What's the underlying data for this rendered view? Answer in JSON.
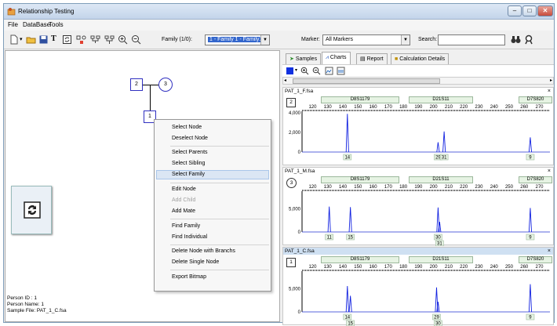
{
  "window": {
    "title": "Relationship Testing",
    "min": "–",
    "max": "□",
    "close": "✕"
  },
  "menu": [
    "File",
    "DataBase",
    "Tools"
  ],
  "toolbar": {
    "family_label": "Family (1/0):",
    "family_value": "1 - Family 1 - Family1",
    "marker_label": "Marker:",
    "marker_value": "All Markers",
    "search_label": "Search:",
    "search_value": ""
  },
  "pedigree": {
    "nodes": [
      {
        "id": "2",
        "shape": "square"
      },
      {
        "id": "3",
        "shape": "circle"
      },
      {
        "id": "1",
        "shape": "square"
      }
    ]
  },
  "context_menu": [
    {
      "label": "Select Node",
      "enabled": true
    },
    {
      "label": "Deselect Node",
      "enabled": true
    },
    {
      "label": "Select Parents",
      "enabled": true
    },
    {
      "label": "Select Sibling",
      "enabled": true
    },
    {
      "label": "Select Family",
      "enabled": true,
      "highlight": true
    },
    {
      "label": "Edit Node",
      "enabled": true
    },
    {
      "label": "Add Child",
      "enabled": false
    },
    {
      "label": "Add Mate",
      "enabled": true
    },
    {
      "label": "Find Family",
      "enabled": true
    },
    {
      "label": "Find Individual",
      "enabled": true
    },
    {
      "label": "Delete Node with Branchs",
      "enabled": true
    },
    {
      "label": "Delete Single Node",
      "enabled": true
    },
    {
      "label": "Export Bitmap",
      "enabled": true
    }
  ],
  "status": {
    "person_id": "Person ID : 1",
    "person_name": "Person Name: 1",
    "sample_file": "Sample File: PAT_1_C.fsa"
  },
  "tabs": [
    "Samples",
    "Charts",
    "Report",
    "Calculation Details"
  ],
  "active_tab": "Charts",
  "chart_data": [
    {
      "type": "line",
      "title": "PAT_1_F.fsa",
      "node": "2",
      "node_shape": "square",
      "markers": [
        "D8S1179",
        "D21S11",
        "D7S820"
      ],
      "x_ticks": [
        "120",
        "130",
        "140",
        "150",
        "160",
        "170",
        "180",
        "190",
        "200",
        "210",
        "220",
        "230",
        "240",
        "250",
        "260",
        "270"
      ],
      "xlim": [
        113,
        277
      ],
      "y_ticks": [
        "0",
        "2,000",
        "4,000"
      ],
      "ylim": [
        0,
        4000
      ],
      "peaks": [
        {
          "x": 143,
          "y": 3900
        },
        {
          "x": 203,
          "y": 1000
        },
        {
          "x": 207,
          "y": 2100
        },
        {
          "x": 264,
          "y": 1500
        }
      ],
      "allele_labels": [
        {
          "x": 143,
          "text": "14",
          "row": 1
        },
        {
          "x": 203,
          "text": "29",
          "row": 1
        },
        {
          "x": 207,
          "text": "31",
          "row": 1
        },
        {
          "x": 264,
          "text": "9",
          "row": 1
        }
      ]
    },
    {
      "type": "line",
      "title": "PAT_1_M.fsa",
      "node": "3",
      "node_shape": "circle",
      "markers": [
        "D8S1179",
        "D21S11",
        "D7S820"
      ],
      "x_ticks": [
        "120",
        "130",
        "140",
        "150",
        "160",
        "170",
        "180",
        "190",
        "200",
        "210",
        "220",
        "230",
        "240",
        "250",
        "260",
        "270"
      ],
      "xlim": [
        113,
        277
      ],
      "y_ticks": [
        "0",
        "5,000"
      ],
      "ylim": [
        0,
        8500
      ],
      "peaks": [
        {
          "x": 131,
          "y": 5500
        },
        {
          "x": 145,
          "y": 5400
        },
        {
          "x": 203,
          "y": 5300
        },
        {
          "x": 204,
          "y": 2200
        },
        {
          "x": 264,
          "y": 5200
        }
      ],
      "allele_labels": [
        {
          "x": 131,
          "text": "11",
          "row": 1
        },
        {
          "x": 145,
          "text": "15",
          "row": 1
        },
        {
          "x": 203,
          "text": "30",
          "row": 1
        },
        {
          "x": 204,
          "text": "31",
          "row": 2
        },
        {
          "x": 264,
          "text": "9",
          "row": 1
        }
      ]
    },
    {
      "type": "line",
      "title": "PAT_1_C.fsa",
      "node": "1",
      "node_shape": "square",
      "selected": true,
      "markers": [
        "D8S1179",
        "D21S11",
        "D7S820"
      ],
      "x_ticks": [
        "120",
        "130",
        "140",
        "150",
        "160",
        "170",
        "180",
        "190",
        "200",
        "210",
        "220",
        "230",
        "240",
        "250",
        "260",
        "270"
      ],
      "xlim": [
        113,
        277
      ],
      "y_ticks": [
        "0",
        "5,000"
      ],
      "ylim": [
        0,
        8500
      ],
      "peaks": [
        {
          "x": 143,
          "y": 5600
        },
        {
          "x": 145,
          "y": 3500
        },
        {
          "x": 202,
          "y": 5300
        },
        {
          "x": 203,
          "y": 2200
        },
        {
          "x": 264,
          "y": 6000
        }
      ],
      "allele_labels": [
        {
          "x": 143,
          "text": "14",
          "row": 1
        },
        {
          "x": 145,
          "text": "15",
          "row": 2
        },
        {
          "x": 202,
          "text": "29",
          "row": 1
        },
        {
          "x": 203,
          "text": "30",
          "row": 2
        },
        {
          "x": 264,
          "text": "9",
          "row": 1
        }
      ]
    }
  ]
}
